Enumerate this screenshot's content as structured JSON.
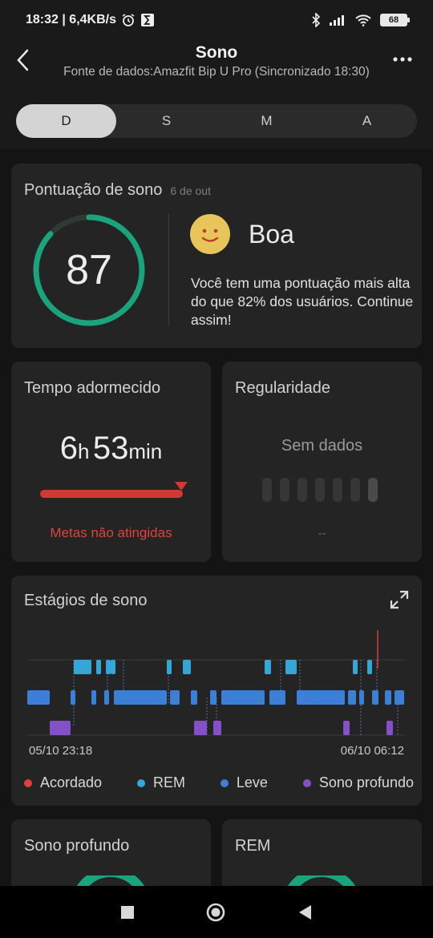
{
  "status": {
    "time_speed": "18:32 | 6,4KB/s",
    "battery": "68"
  },
  "header": {
    "title": "Sono",
    "subtitle": "Fonte de dados:Amazfit Bip U Pro (Sincronizado 18:30)"
  },
  "tabs": [
    {
      "label": "D",
      "active": true
    },
    {
      "label": "S",
      "active": false
    },
    {
      "label": "M",
      "active": false
    },
    {
      "label": "A",
      "active": false
    }
  ],
  "score": {
    "title": "Pontuação de sono",
    "date": "6 de out",
    "value": "87",
    "value_fraction": 0.87,
    "rating": "Boa",
    "description": "Você tem uma pontuação mais alta do que 82% dos usuários. Continue assim!",
    "ring_color": "#1aa47e"
  },
  "time_asleep": {
    "title": "Tempo adormecido",
    "hours": "6",
    "hours_unit": "h",
    "minutes": "53",
    "minutes_unit": "min",
    "goal_status": "Metas não atingidas",
    "bar_color": "#d03a30"
  },
  "regularity": {
    "title": "Regularidade",
    "no_data": "Sem dados",
    "placeholder": "--"
  },
  "stages": {
    "title": "Estágios de sono",
    "start_label": "05/10 23:18",
    "end_label": "06/10 06:12",
    "legend": [
      {
        "label": "Acordado",
        "color": "#e0403a"
      },
      {
        "label": "REM",
        "color": "#35a6d6"
      },
      {
        "label": "Leve",
        "color": "#3b7fd6"
      },
      {
        "label": "Sono profundo",
        "color": "#8450c8"
      }
    ]
  },
  "deep_sleep": {
    "title": "Sono profundo"
  },
  "rem": {
    "title": "REM"
  }
}
